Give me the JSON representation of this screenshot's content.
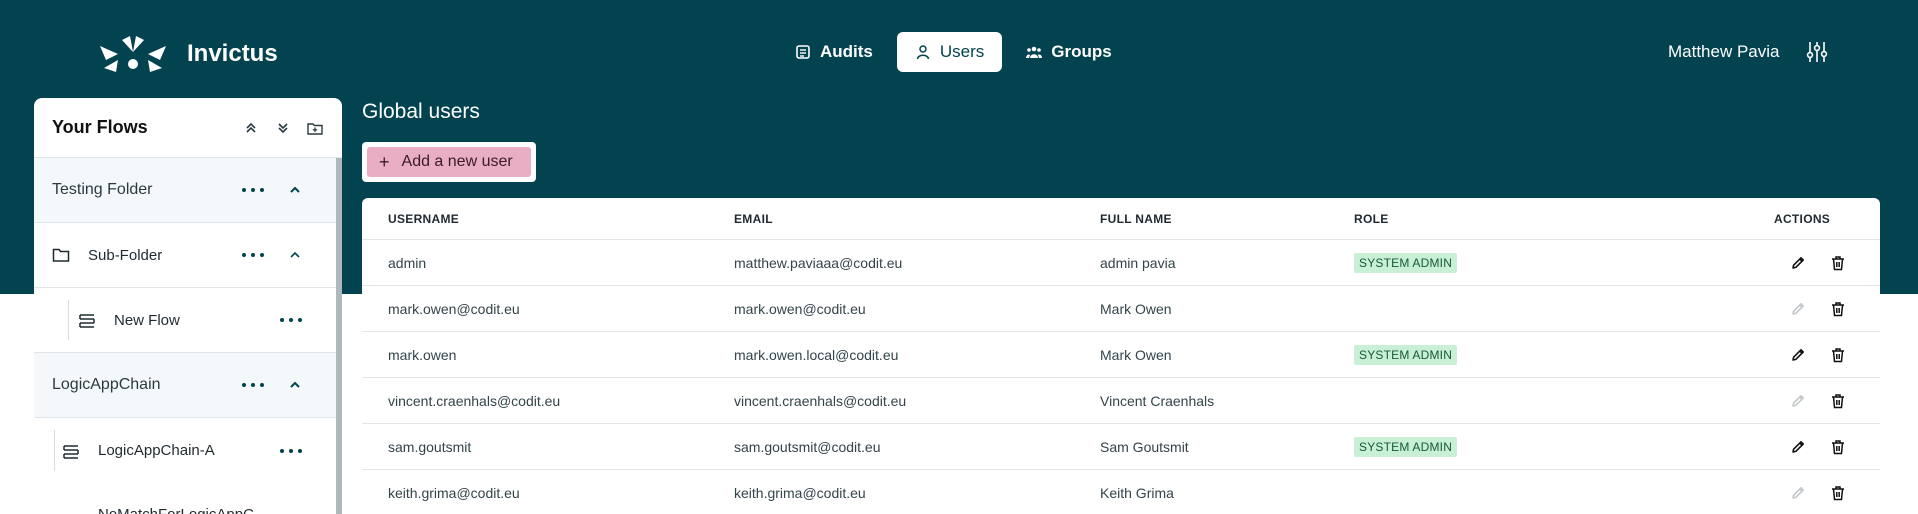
{
  "app": {
    "name": "Invictus"
  },
  "nav": {
    "items": [
      {
        "label": "Audits",
        "icon": "audit-icon",
        "active": false
      },
      {
        "label": "Users",
        "icon": "user-icon",
        "active": true
      },
      {
        "label": "Groups",
        "icon": "groups-icon",
        "active": false
      }
    ]
  },
  "header": {
    "user_name": "Matthew Pavia",
    "settings_icon": "sliders-icon"
  },
  "sidebar": {
    "title": "Your Flows",
    "items": [
      {
        "label": "Testing Folder",
        "type": "folder",
        "level": 0
      },
      {
        "label": "Sub-Folder",
        "type": "subfolder",
        "level": 1
      },
      {
        "label": "New Flow",
        "type": "flow",
        "level": 2
      },
      {
        "label": "LogicAppChain",
        "type": "folder",
        "level": 0
      },
      {
        "label": "LogicAppChain-A",
        "type": "flow",
        "level": 1
      },
      {
        "label": "NoMatchForLogicAppC",
        "type": "flow",
        "level": 1
      }
    ]
  },
  "main": {
    "title": "Global users",
    "add_button": "Add a new user",
    "columns": [
      "USERNAME",
      "EMAIL",
      "FULL NAME",
      "ROLE",
      "ACTIONS"
    ],
    "rows": [
      {
        "username": "admin",
        "email": "matthew.paviaaa@codit.eu",
        "full_name": "admin pavia",
        "role": "SYSTEM ADMIN",
        "edit_enabled": true
      },
      {
        "username": "mark.owen@codit.eu",
        "email": "mark.owen@codit.eu",
        "full_name": "Mark Owen",
        "role": "",
        "edit_enabled": false
      },
      {
        "username": "mark.owen",
        "email": "mark.owen.local@codit.eu",
        "full_name": "Mark Owen",
        "role": "SYSTEM ADMIN",
        "edit_enabled": true
      },
      {
        "username": "vincent.craenhals@codit.eu",
        "email": "vincent.craenhals@codit.eu",
        "full_name": "Vincent Craenhals",
        "role": "",
        "edit_enabled": false
      },
      {
        "username": "sam.goutsmit",
        "email": "sam.goutsmit@codit.eu",
        "full_name": "Sam Goutsmit",
        "role": "SYSTEM ADMIN",
        "edit_enabled": true
      },
      {
        "username": "keith.grima@codit.eu",
        "email": "keith.grima@codit.eu",
        "full_name": "Keith Grima",
        "role": "",
        "edit_enabled": false
      }
    ]
  },
  "colors": {
    "brand": "#02434f",
    "accent_button": "#e9aec4",
    "role_badge": "#c9f0d7"
  }
}
